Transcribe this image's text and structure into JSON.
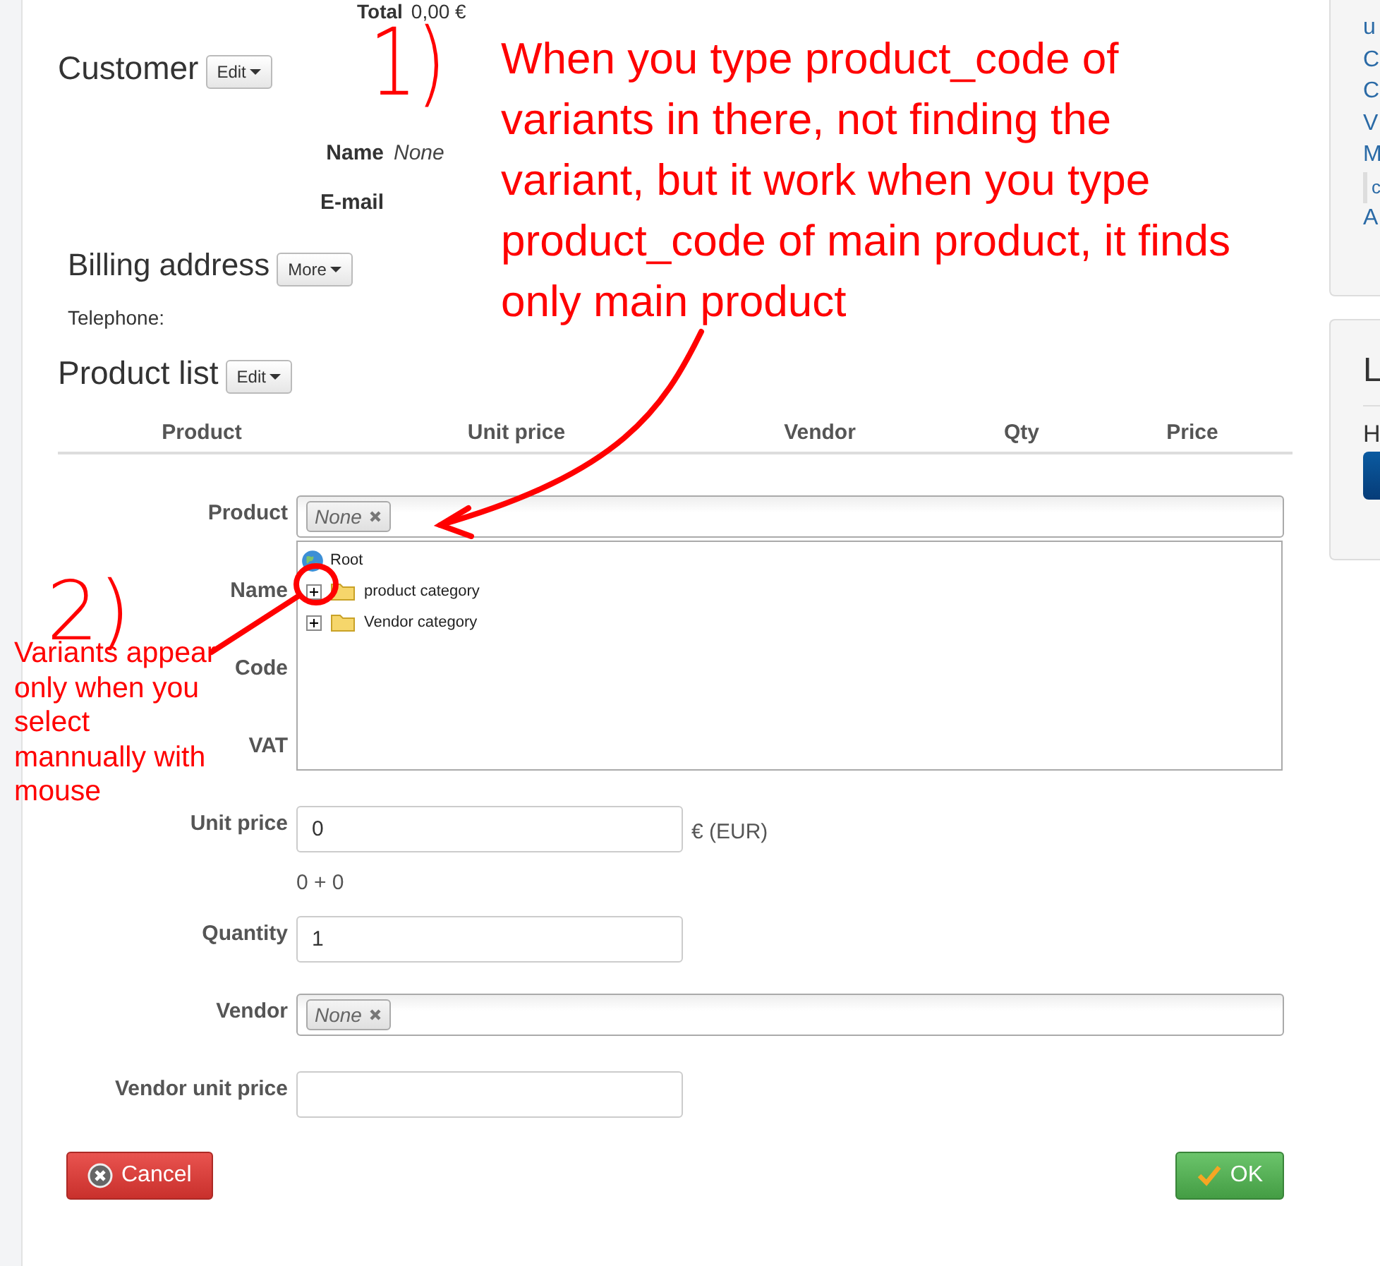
{
  "summary": {
    "total_label": "Total",
    "total_value": "0,00 €"
  },
  "customer": {
    "title": "Customer",
    "button": "Edit",
    "fields": [
      {
        "label": "Name",
        "value": "None"
      },
      {
        "label": "E-mail"
      }
    ]
  },
  "billing": {
    "title": "Billing address",
    "button": "More",
    "telephone_label": "Telephone:"
  },
  "product_list": {
    "title": "Product list",
    "button": "Edit",
    "columns": [
      "Product",
      "Unit price",
      "Vendor",
      "Qty",
      "Price"
    ]
  },
  "form": {
    "fields": [
      {
        "kind": "select",
        "label": "Product",
        "tag": "None"
      },
      {
        "kind": "covered",
        "label": "Name"
      },
      {
        "kind": "covered",
        "label": "Code"
      },
      {
        "kind": "covered",
        "label": "VAT"
      },
      {
        "kind": "input",
        "label": "Unit price",
        "value": "0",
        "suffix": "€ (EUR)"
      },
      {
        "kind": "note",
        "text": "0 + 0"
      },
      {
        "kind": "input",
        "label": "Quantity",
        "value": "1"
      },
      {
        "kind": "select",
        "label": "Vendor",
        "tag": "None"
      },
      {
        "kind": "input",
        "label": "Vendor unit price"
      }
    ]
  },
  "tree": {
    "items": [
      {
        "label": "Root",
        "children": [
          {
            "label": "product category",
            "expanded": false
          },
          {
            "label": "Vendor category",
            "expanded": false
          }
        ]
      }
    ]
  },
  "buttons": {
    "cancel": "Cancel",
    "ok": "OK"
  },
  "sidebar": {
    "links": [
      "u",
      "C",
      "C",
      "V",
      "M"
    ],
    "quote": "c",
    "last_link": "A",
    "panel_title": "L",
    "panel_text": "H"
  },
  "annotations": [
    {
      "mark": "1)",
      "text": "When you type product_code of\nvariants in there, not finding the\nvariant, but it work when you type\nproduct_code of main product, it finds\nonly main product"
    },
    {
      "mark": "2)",
      "text": "Variants appear\nonly when you\nselect\nmannually with\nmouse"
    }
  ]
}
